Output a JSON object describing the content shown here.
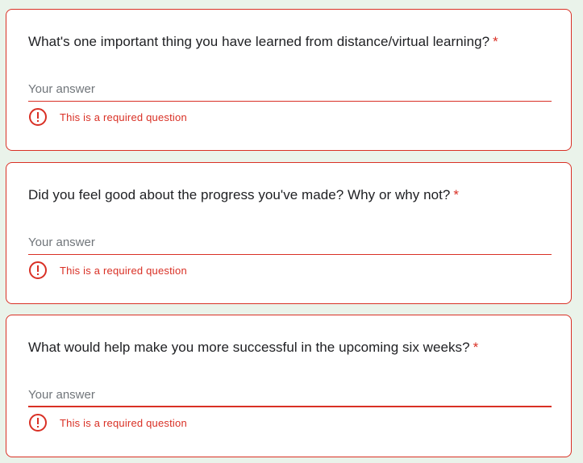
{
  "questions": [
    {
      "title": "What's one important thing you have learned from distance/virtual learning?",
      "required_mark": "*",
      "placeholder": "Your answer",
      "error": "This is a required question"
    },
    {
      "title": "Did you feel good about the progress you've made? Why or why not?",
      "required_mark": "*",
      "placeholder": "Your answer",
      "error": "This is a required question"
    },
    {
      "title": "What would help make you more successful in the upcoming six weeks?",
      "required_mark": "*",
      "placeholder": "Your answer",
      "error": "This is a required question"
    }
  ],
  "colors": {
    "error": "#d93025",
    "page_background": "#eaf3ea",
    "card_background": "#ffffff"
  },
  "icons": {
    "error": "error-outline-icon"
  }
}
